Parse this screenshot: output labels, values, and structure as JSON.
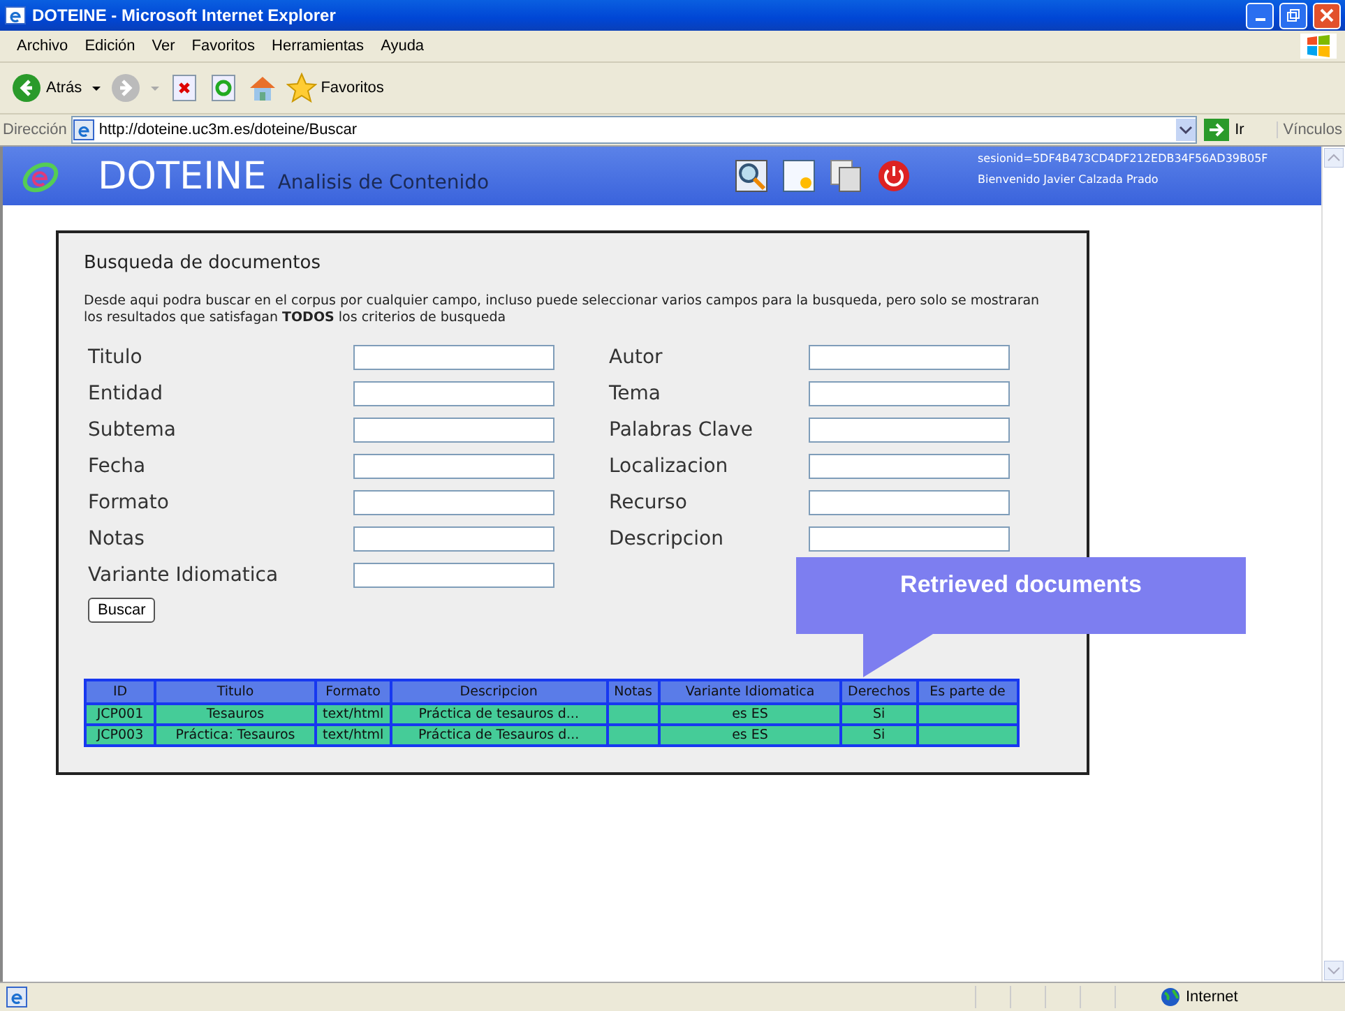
{
  "window": {
    "title": "DOTEINE - Microsoft Internet Explorer"
  },
  "menu": [
    "Archivo",
    "Edición",
    "Ver",
    "Favoritos",
    "Herramientas",
    "Ayuda"
  ],
  "toolbar": {
    "back": "Atrás",
    "favorites": "Favoritos"
  },
  "address_bar": {
    "label": "Dirección",
    "url": "http://doteine.uc3m.es/doteine/Buscar",
    "go": "Ir",
    "links": "Vínculos"
  },
  "header": {
    "logo": "DOTEINE",
    "subtitle": "Analisis de Contenido",
    "session": "sesionid=5DF4B473CD4DF212EDB34F56AD39B05F",
    "welcome": "Bienvenido Javier Calzada Prado"
  },
  "panel": {
    "title": "Busqueda de documentos",
    "description": "Desde aqui podra buscar en el corpus por cualquier campo, incluso puede seleccionar varios campos para la busqueda, pero solo se mostraran los resultados que satisfagan **TODOS** los criterios de busqueda",
    "fields_left": [
      {
        "label": "Titulo"
      },
      {
        "label": "Entidad"
      },
      {
        "label": "Subtema"
      },
      {
        "label": "Fecha"
      },
      {
        "label": "Formato"
      },
      {
        "label": "Notas"
      },
      {
        "label": "Variante Idiomatica"
      }
    ],
    "fields_right": [
      {
        "label": "Autor"
      },
      {
        "label": "Tema"
      },
      {
        "label": "Palabras Clave"
      },
      {
        "label": "Localizacion"
      },
      {
        "label": "Recurso"
      },
      {
        "label": "Descripcion"
      }
    ],
    "button": "Buscar"
  },
  "table": {
    "columns": [
      "ID",
      "Titulo",
      "Formato",
      "Descripcion",
      "Notas",
      "Variante Idiomatica",
      "Derechos",
      "Es parte de"
    ],
    "rows": [
      [
        "JCP001",
        "Tesauros",
        "text/html",
        "Práctica de tesauros d...",
        "",
        "es ES",
        "Si",
        ""
      ],
      [
        "JCP003",
        "Práctica: Tesauros",
        "text/html",
        "Práctica de Tesauros d...",
        "",
        "es ES",
        "Si",
        ""
      ]
    ]
  },
  "callout": "Retrieved documents",
  "status_bar": {
    "zone": "Internet"
  }
}
